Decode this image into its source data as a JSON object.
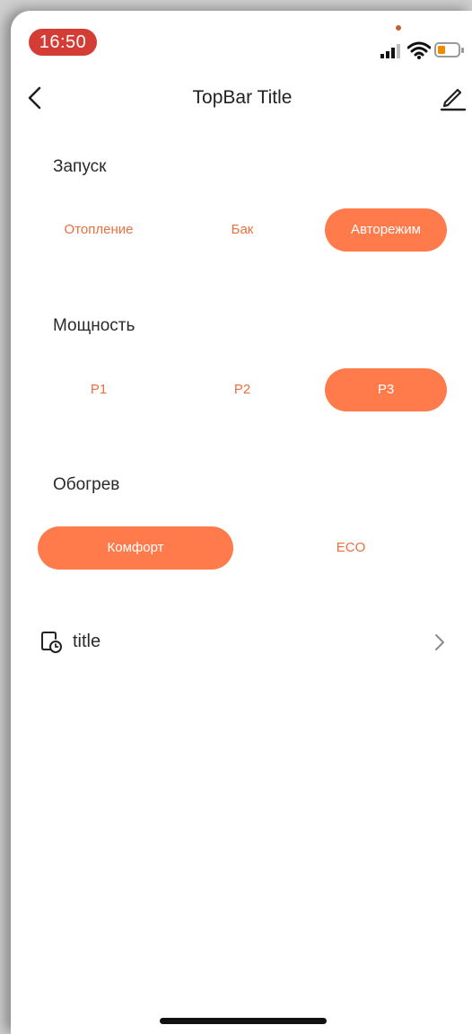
{
  "status_bar": {
    "time": "16:50",
    "icons": [
      "cellular-signal-icon",
      "wifi-icon",
      "battery-icon"
    ],
    "battery_color": "#f08a00"
  },
  "top_bar": {
    "title": "TopBar Title",
    "back_icon": "chevron-left-icon",
    "edit_icon": "pencil-icon"
  },
  "colors": {
    "accent": "#ff7b4c",
    "accent_text": "#e8703f",
    "time_pill": "#d33d36"
  },
  "sections": {
    "launch": {
      "label": "Запуск",
      "options": [
        "Отопление",
        "Бак",
        "Авторежим"
      ],
      "selected": "Авторежим"
    },
    "power": {
      "label": "Мощность",
      "options": [
        "P1",
        "P2",
        "P3"
      ],
      "selected": "P3"
    },
    "heating": {
      "label": "Обогрев",
      "options": [
        "Комфорт",
        "ECO"
      ],
      "selected": "Комфорт"
    }
  },
  "list_item": {
    "title": "title",
    "icon": "timer-document-icon",
    "chevron": "chevron-right-icon"
  }
}
